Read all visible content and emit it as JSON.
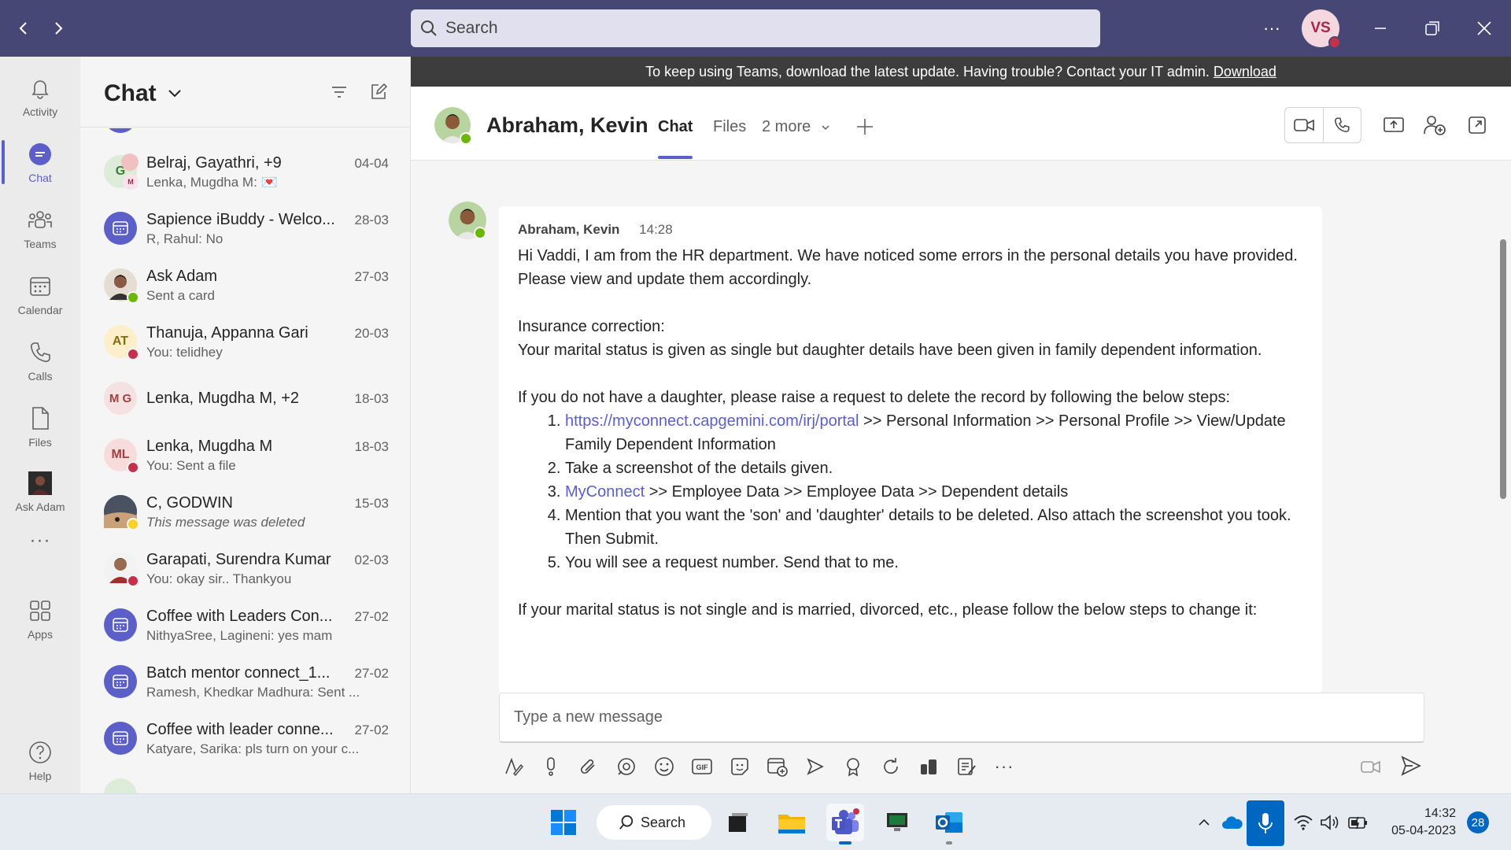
{
  "titlebar": {
    "search_placeholder": "Search",
    "more_label": "···",
    "user_initials": "VS"
  },
  "rail": {
    "items": [
      {
        "label": "Activity",
        "icon": "bell-icon"
      },
      {
        "label": "Chat",
        "icon": "chat-icon"
      },
      {
        "label": "Teams",
        "icon": "teams-icon"
      },
      {
        "label": "Calendar",
        "icon": "calendar-icon"
      },
      {
        "label": "Calls",
        "icon": "phone-icon"
      },
      {
        "label": "Files",
        "icon": "file-icon"
      },
      {
        "label": "Ask Adam",
        "icon": "bot-icon"
      },
      {
        "label": "···",
        "icon": "more-icon"
      },
      {
        "label": "Apps",
        "icon": "apps-icon"
      },
      {
        "label": "Help",
        "icon": "help-icon"
      }
    ]
  },
  "chat_list": {
    "title": "Chat",
    "rows": [
      {
        "name": "Belraj, Gayathri, +9",
        "preview": "Lenka, Mugdha M: 💌",
        "date": "04-04",
        "initials": "G"
      },
      {
        "name": "Sapience iBuddy - Welco...",
        "preview": "R, Rahul: No",
        "date": "28-03"
      },
      {
        "name": "Ask Adam",
        "preview": "Sent a card",
        "date": "27-03"
      },
      {
        "name": "Thanuja, Appanna Gari",
        "preview": "You: telidhey",
        "date": "20-03",
        "initials": "AT"
      },
      {
        "name": "Lenka, Mugdha M, +2",
        "preview": "",
        "date": "18-03",
        "initials": "M G"
      },
      {
        "name": "Lenka, Mugdha M",
        "preview": "You: Sent a file",
        "date": "18-03",
        "initials": "ML"
      },
      {
        "name": "C, GODWIN",
        "preview": "This message was deleted",
        "date": "15-03"
      },
      {
        "name": "Garapati, Surendra Kumar",
        "preview": "You: okay sir.. Thankyou",
        "date": "02-03"
      },
      {
        "name": "Coffee with Leaders Con...",
        "preview": "NithyaSree, Lagineni: yes mam",
        "date": "27-02"
      },
      {
        "name": "Batch mentor connect_1...",
        "preview": "Ramesh, Khedkar Madhura: Sent ...",
        "date": "27-02"
      },
      {
        "name": "Coffee with leader conne...",
        "preview": "Katyare, Sarika: pls turn on your c...",
        "date": "27-02"
      }
    ]
  },
  "banner": {
    "text": "To keep using Teams, download the latest update. Having trouble? Contact your IT admin.",
    "link": "Download"
  },
  "chat_header": {
    "name": "Abraham, Kevin",
    "tabs": [
      "Chat",
      "Files",
      "2 more"
    ]
  },
  "message": {
    "author": "Abraham, Kevin",
    "time": "14:28",
    "p1": "Hi Vaddi, I am from the HR department. We have noticed some errors in the personal details you have provided. Please view and update them accordingly.",
    "p2_title": "Insurance correction:",
    "p2_body": "Your marital status is given as single but daughter details have been given in family dependent information.",
    "p3": "If you do not have a daughter, please raise a request to delete the record by following the below steps:",
    "step1_link": "https://myconnect.capgemini.com/irj/portal",
    "step1_rest": " >> Personal Information >> Personal Profile >> View/Update Family Dependent Information",
    "step2": "Take a screenshot of the details given.",
    "step3_link": "MyConnect",
    "step3_rest": " >> Employee Data >> Employee Data >> Dependent details",
    "step4": "Mention that you want the 'son' and 'daughter' details to be deleted. Also attach the screenshot you took. Then Submit.",
    "step5": "You will see a request number. Send that to me.",
    "p4": "If your marital status is not single and is married, divorced, etc., please follow the below steps to change it:"
  },
  "composer": {
    "placeholder": "Type a new message"
  },
  "taskbar": {
    "search_label": "Search",
    "time": "14:32",
    "date": "05-04-2023",
    "notifications": "28"
  },
  "colors": {
    "titlebar": "#464775",
    "accent": "#5b5fc7",
    "presence_available": "#6bb700",
    "presence_busy": "#c4314b"
  }
}
